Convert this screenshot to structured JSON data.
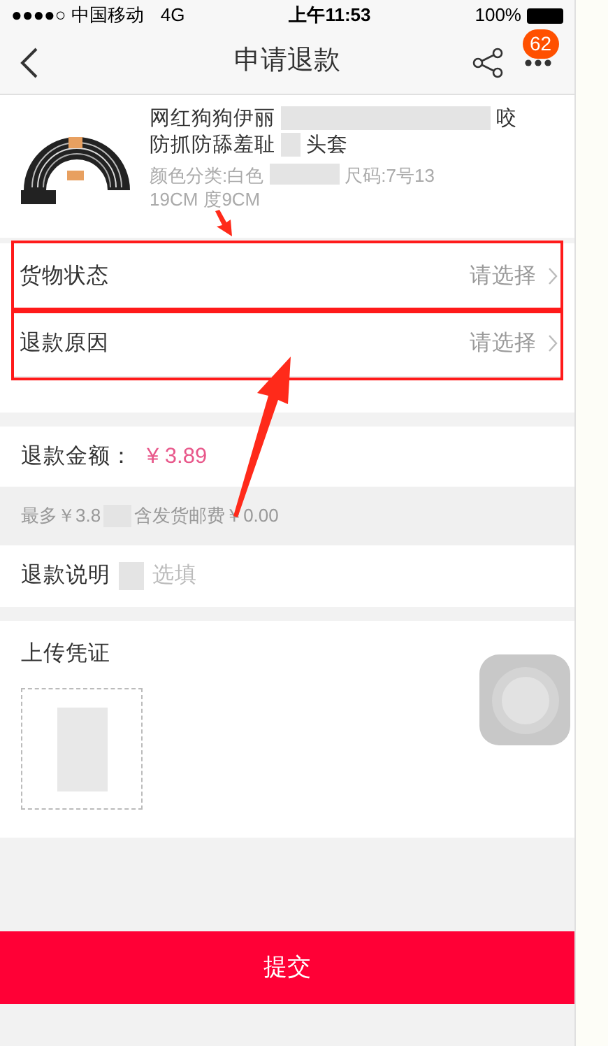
{
  "status_bar": {
    "carrier": "●●●●○ 中国移动",
    "network": "4G",
    "time": "上午11:53",
    "battery": "100%"
  },
  "nav": {
    "title": "申请退款",
    "badge": "62"
  },
  "product": {
    "title_line_1": "网红狗狗伊丽",
    "title_line_1_end": "咬",
    "title_line_2": "防抓防舔羞耻",
    "title_line_2_end": "头套",
    "spec_line_1": "颜色分类:白色",
    "spec_line_1_end": "尺码:7号13",
    "spec_line_2": "19CM",
    "spec_line_2_end": "度9CM"
  },
  "selects": [
    {
      "label": "货物状态",
      "value": "请选择",
      "highlighted": true
    },
    {
      "label": "退款原因",
      "value": "请选择",
      "highlighted": true
    }
  ],
  "amount": {
    "label": "退款金额：",
    "value": "¥ 3.89",
    "note_start": "最多￥3.8",
    "note_end": "含发货邮费￥0.00"
  },
  "description": {
    "label": "退款说明",
    "placeholder": "选填"
  },
  "upload": {
    "label": "上传凭证"
  },
  "submit": "提交"
}
